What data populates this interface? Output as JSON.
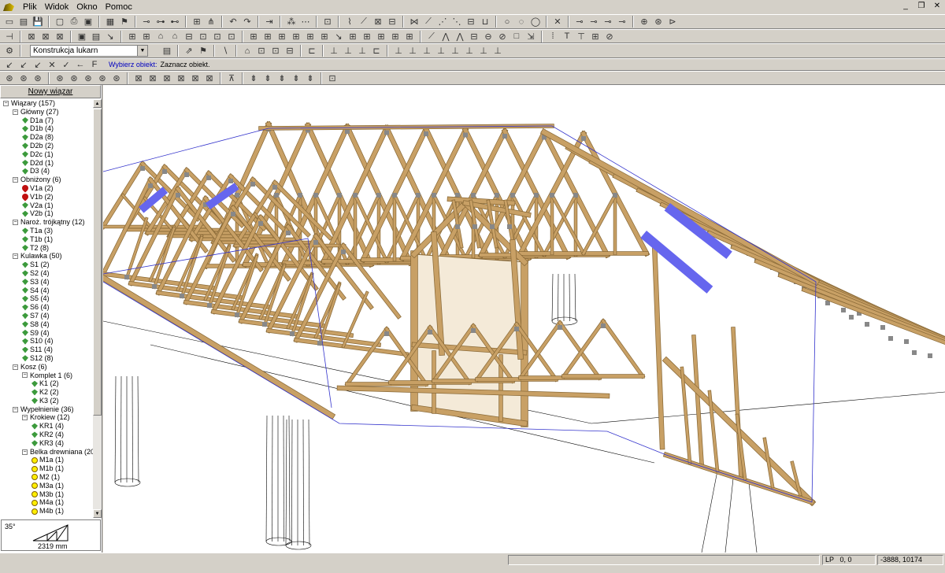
{
  "menu": {
    "items": [
      "Plik",
      "Widok",
      "Okno",
      "Pomoc"
    ]
  },
  "toolbar3": {
    "combo_value": "Konstrukcja lukarn"
  },
  "command_line": {
    "prompt": "Wybierz obiekt:",
    "message": "Zaznacz obiekt."
  },
  "left_panel": {
    "new_button": "Nowy wiązar"
  },
  "tree": [
    {
      "level": 0,
      "label": "Wiązary (157)",
      "expander": "−",
      "icon": ""
    },
    {
      "level": 1,
      "label": "Główny (27)",
      "expander": "−",
      "icon": ""
    },
    {
      "level": 2,
      "label": "D1a (7)",
      "icon": "green"
    },
    {
      "level": 2,
      "label": "D1b (4)",
      "icon": "green"
    },
    {
      "level": 2,
      "label": "D2a (8)",
      "icon": "green"
    },
    {
      "level": 2,
      "label": "D2b (2)",
      "icon": "green"
    },
    {
      "level": 2,
      "label": "D2c (1)",
      "icon": "green"
    },
    {
      "level": 2,
      "label": "D2d (1)",
      "icon": "green"
    },
    {
      "level": 2,
      "label": "D3 (4)",
      "icon": "green"
    },
    {
      "level": 1,
      "label": "Obniżony (6)",
      "expander": "−",
      "icon": ""
    },
    {
      "level": 2,
      "label": "V1a (2)",
      "icon": "red"
    },
    {
      "level": 2,
      "label": "V1b (2)",
      "icon": "red"
    },
    {
      "level": 2,
      "label": "V2a (1)",
      "icon": "green"
    },
    {
      "level": 2,
      "label": "V2b (1)",
      "icon": "green"
    },
    {
      "level": 1,
      "label": "Naroż. trójkątny (12)",
      "expander": "−",
      "icon": ""
    },
    {
      "level": 2,
      "label": "T1a (3)",
      "icon": "green"
    },
    {
      "level": 2,
      "label": "T1b (1)",
      "icon": "green"
    },
    {
      "level": 2,
      "label": "T2 (8)",
      "icon": "green"
    },
    {
      "level": 1,
      "label": "Kulawka (50)",
      "expander": "−",
      "icon": ""
    },
    {
      "level": 2,
      "label": "S1 (2)",
      "icon": "green"
    },
    {
      "level": 2,
      "label": "S2 (4)",
      "icon": "green"
    },
    {
      "level": 2,
      "label": "S3 (4)",
      "icon": "green"
    },
    {
      "level": 2,
      "label": "S4 (4)",
      "icon": "green"
    },
    {
      "level": 2,
      "label": "S5 (4)",
      "icon": "green"
    },
    {
      "level": 2,
      "label": "S6 (4)",
      "icon": "green"
    },
    {
      "level": 2,
      "label": "S7 (4)",
      "icon": "green"
    },
    {
      "level": 2,
      "label": "S8 (4)",
      "icon": "green"
    },
    {
      "level": 2,
      "label": "S9 (4)",
      "icon": "green"
    },
    {
      "level": 2,
      "label": "S10 (4)",
      "icon": "green"
    },
    {
      "level": 2,
      "label": "S11 (4)",
      "icon": "green"
    },
    {
      "level": 2,
      "label": "S12 (8)",
      "icon": "green"
    },
    {
      "level": 1,
      "label": "Kosz (6)",
      "expander": "−",
      "icon": ""
    },
    {
      "level": 2,
      "label": "Komplet 1 (6)",
      "expander": "−",
      "icon": ""
    },
    {
      "level": 3,
      "label": "K1 (2)",
      "icon": "green"
    },
    {
      "level": 3,
      "label": "K2 (2)",
      "icon": "green"
    },
    {
      "level": 3,
      "label": "K3 (2)",
      "icon": "green"
    },
    {
      "level": 1,
      "label": "Wypełnienie (36)",
      "expander": "−",
      "icon": ""
    },
    {
      "level": 2,
      "label": "Krokiew (12)",
      "expander": "−",
      "icon": ""
    },
    {
      "level": 3,
      "label": "KR1 (4)",
      "icon": "green"
    },
    {
      "level": 3,
      "label": "KR2 (4)",
      "icon": "green"
    },
    {
      "level": 3,
      "label": "KR3 (4)",
      "icon": "green"
    },
    {
      "level": 2,
      "label": "Belka drewniana (20)",
      "expander": "−",
      "icon": ""
    },
    {
      "level": 3,
      "label": "M1a (1)",
      "icon": "yellow"
    },
    {
      "level": 3,
      "label": "M1b (1)",
      "icon": "yellow"
    },
    {
      "level": 3,
      "label": "M2 (1)",
      "icon": "yellow"
    },
    {
      "level": 3,
      "label": "M3a (1)",
      "icon": "yellow"
    },
    {
      "level": 3,
      "label": "M3b (1)",
      "icon": "yellow"
    },
    {
      "level": 3,
      "label": "M4a (1)",
      "icon": "yellow"
    },
    {
      "level": 3,
      "label": "M4b (1)",
      "icon": "yellow"
    }
  ],
  "preview": {
    "angle": "35°",
    "length": "2319 mm"
  },
  "status": {
    "lp": "LP",
    "lp_value": "0,  0",
    "coords": "-3888, 10174"
  },
  "colors": {
    "timber": "#c8a065",
    "timber_dark": "#8a6a38",
    "selection": "#6666ee",
    "plate": "#888888"
  }
}
